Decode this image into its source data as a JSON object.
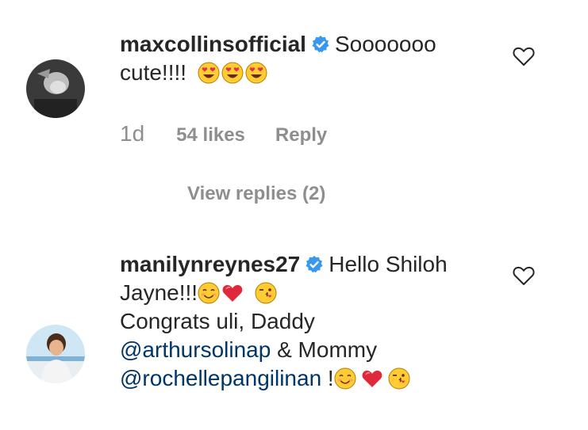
{
  "comments": [
    {
      "username": "maxcollinsofficial",
      "text_1": "Sooooooo",
      "text_2": "cute!!!!",
      "time": "1d",
      "likes": "54 likes",
      "reply": "Reply",
      "view_replies": "View replies (2)"
    },
    {
      "username": "manilynreynes27",
      "text_1": "Hello Shiloh",
      "text_2": "Jayne!!!",
      "text_3": "Congrats uli, Daddy",
      "mention_1": "@arthursolinap",
      "text_4": " & Mommy",
      "mention_2": "@rochellepangilinan",
      "text_5": " !"
    }
  ],
  "icons": {
    "verified": "verified-badge-icon",
    "like": "heart-outline-icon",
    "emoji_heart_eyes": "heart-eyes-emoji",
    "emoji_smile": "smiling-face-emoji",
    "emoji_heart": "red-heart-emoji",
    "emoji_wink": "wink-kiss-emoji"
  },
  "colors": {
    "verified": "#3897f0",
    "mention": "#003569",
    "meta": "#8e8e8e"
  }
}
